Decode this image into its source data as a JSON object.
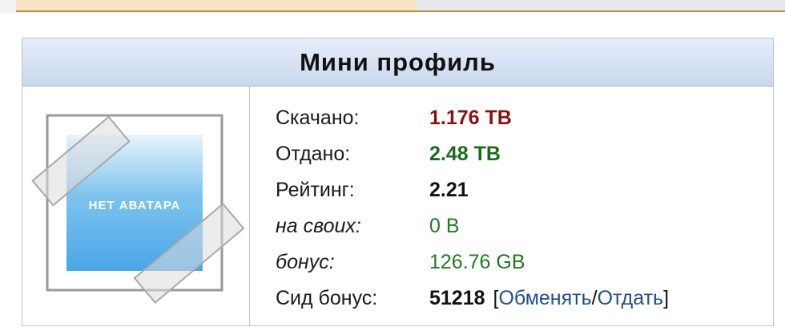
{
  "panel": {
    "title": "Мини профиль"
  },
  "avatar": {
    "text": "НЕТ АВАТАРА"
  },
  "stats": {
    "downloaded": {
      "label": "Скачано:",
      "value": "1.176 TB"
    },
    "uploaded": {
      "label": "Отдано:",
      "value": "2.48 TB"
    },
    "rating": {
      "label": "Рейтинг:",
      "value": "2.21"
    },
    "own": {
      "label": "на своих:",
      "value": "0 B"
    },
    "bonus": {
      "label": "бонус:",
      "value": "126.76 GB"
    },
    "seed_bonus": {
      "label": "Сид бонус:",
      "value": "51218",
      "bracket_open": "[",
      "exchange_link": "Обменять",
      "separator": "/",
      "give_link": "Отдать",
      "bracket_close": "]"
    }
  },
  "colors": {
    "header_gradient_top": "#e6edf8",
    "header_gradient_bottom": "#c9d8ef",
    "downloaded": "#8a1111",
    "uploaded": "#1b6b1b",
    "link": "#1d4f8c"
  }
}
